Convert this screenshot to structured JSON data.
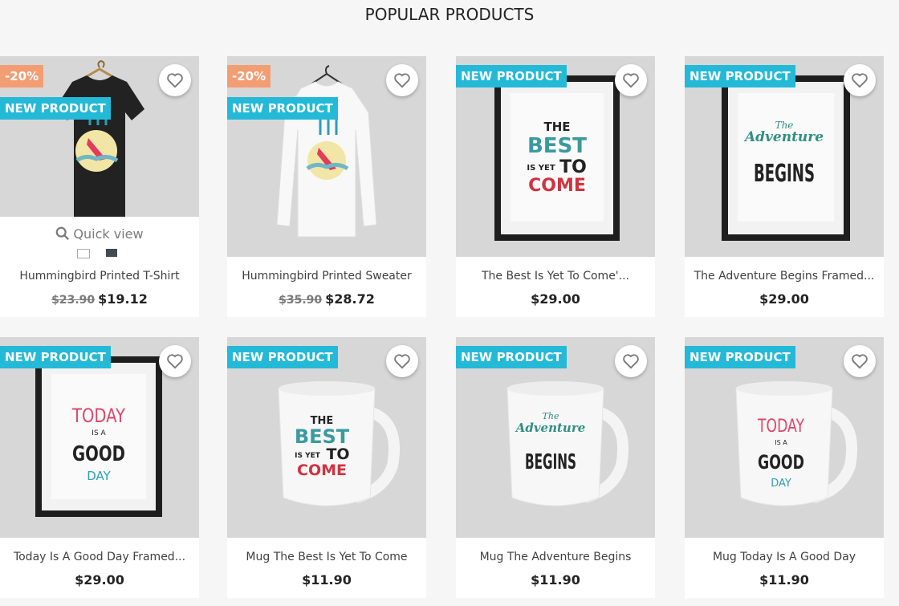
{
  "section": {
    "title": "POPULAR PRODUCTS"
  },
  "labels": {
    "quick_view": "Quick view"
  },
  "colors": {
    "new_flag": "#24b9d7",
    "discount_flag": "#f39d72",
    "thumb_bg": "#d7d7d7"
  },
  "products": [
    {
      "name": "Hummingbird Printed T-Shirt",
      "old_price": "$23.90",
      "price": "$19.12",
      "discount": "-20%",
      "flag": "NEW PRODUCT"
    },
    {
      "name": "Hummingbird Printed Sweater",
      "old_price": "$35.90",
      "price": "$28.72",
      "discount": "-20%",
      "flag": "NEW PRODUCT"
    },
    {
      "name": "The Best Is Yet To Come'...",
      "price": "$29.00",
      "flag": "NEW PRODUCT"
    },
    {
      "name": "The Adventure Begins Framed...",
      "price": "$29.00",
      "flag": "NEW PRODUCT"
    },
    {
      "name": "Today Is A Good Day Framed...",
      "price": "$29.00",
      "flag": "NEW PRODUCT"
    },
    {
      "name": "Mug The Best Is Yet To Come",
      "price": "$11.90",
      "flag": "NEW PRODUCT"
    },
    {
      "name": "Mug The Adventure Begins",
      "price": "$11.90",
      "flag": "NEW PRODUCT"
    },
    {
      "name": "Mug Today Is A Good Day",
      "price": "$11.90",
      "flag": "NEW PRODUCT"
    }
  ],
  "art": {
    "best": [
      "THE",
      "BEST",
      "IS YET",
      "TO",
      "COME"
    ],
    "adventure": [
      "The",
      "Adventure",
      "BEGINS"
    ],
    "today": [
      "TODAY",
      "IS A",
      "GOOD",
      "DAY"
    ]
  }
}
